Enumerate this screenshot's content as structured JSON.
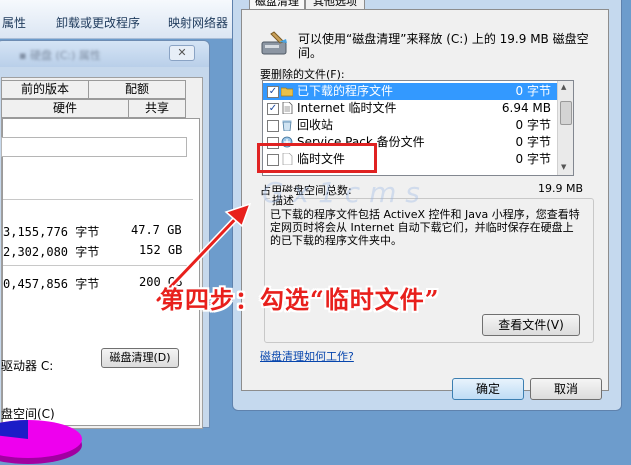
{
  "explorer_toolbar": {
    "items": [
      "属性",
      "卸载或更改程序",
      "映射网络器"
    ]
  },
  "properties_window": {
    "title_blurred": "▪ 硬盘 (C:) 属性",
    "tabs_row1": [
      "前的版本",
      "配额"
    ],
    "tabs_row2": [
      "硬件",
      "共享"
    ],
    "rows": [
      {
        "bytes": "3,155,776 字节",
        "size": "47.7 GB"
      },
      {
        "bytes": "2,302,080 字节",
        "size": "152 GB"
      },
      {
        "bytes": "0,457,856 字节",
        "size": "200 GB"
      }
    ],
    "drive_label": "驱动器 C:",
    "cleanup_button": "磁盘清理(D)",
    "compress_label": "盘空间(C)",
    "colors": {
      "used": "#1c1cc7",
      "free": "#ee00ee"
    }
  },
  "cleanup_dialog": {
    "tabs": [
      "磁盘清理",
      "其他选项"
    ],
    "intro": "可以使用“磁盘清理”来释放 (C:) 上的 19.9 MB 磁盘空间。",
    "files_label": "要删除的文件(F):",
    "files": [
      {
        "name": "已下载的程序文件",
        "size": "0 字节",
        "checked": true,
        "selected": true,
        "icon": "folder-icon"
      },
      {
        "name": "Internet 临时文件",
        "size": "6.94 MB",
        "checked": true,
        "selected": false,
        "icon": "document-icon"
      },
      {
        "name": "回收站",
        "size": "0 字节",
        "checked": false,
        "selected": false,
        "icon": "recycle-bin-icon"
      },
      {
        "name": "Service Pack 备份文件",
        "size": "0 字节",
        "checked": false,
        "selected": false,
        "icon": "backup-icon"
      },
      {
        "name": "临时文件",
        "size": "0 字节",
        "checked": false,
        "selected": false,
        "icon": "blank-file-icon"
      }
    ],
    "total_label": "占用磁盘空间总数:",
    "total_value": "19.9 MB",
    "desc_legend": "描述",
    "description": "已下载的程序文件包括 ActiveX 控件和 Java 小程序，您查看特定网页时将会从 Internet 自动下载它们，并临时保存在硬盘上的已下载的程序文件夹中。",
    "view_files_button": "查看文件(V)",
    "help_link": "磁盘清理如何工作?",
    "ok_button": "确定",
    "cancel_button": "取消",
    "selection_color": "#3399ff"
  },
  "annotation": {
    "text": "第四步：勾选“临时文件”",
    "color": "#e8201c"
  },
  "watermark": "G x 1 c m s"
}
